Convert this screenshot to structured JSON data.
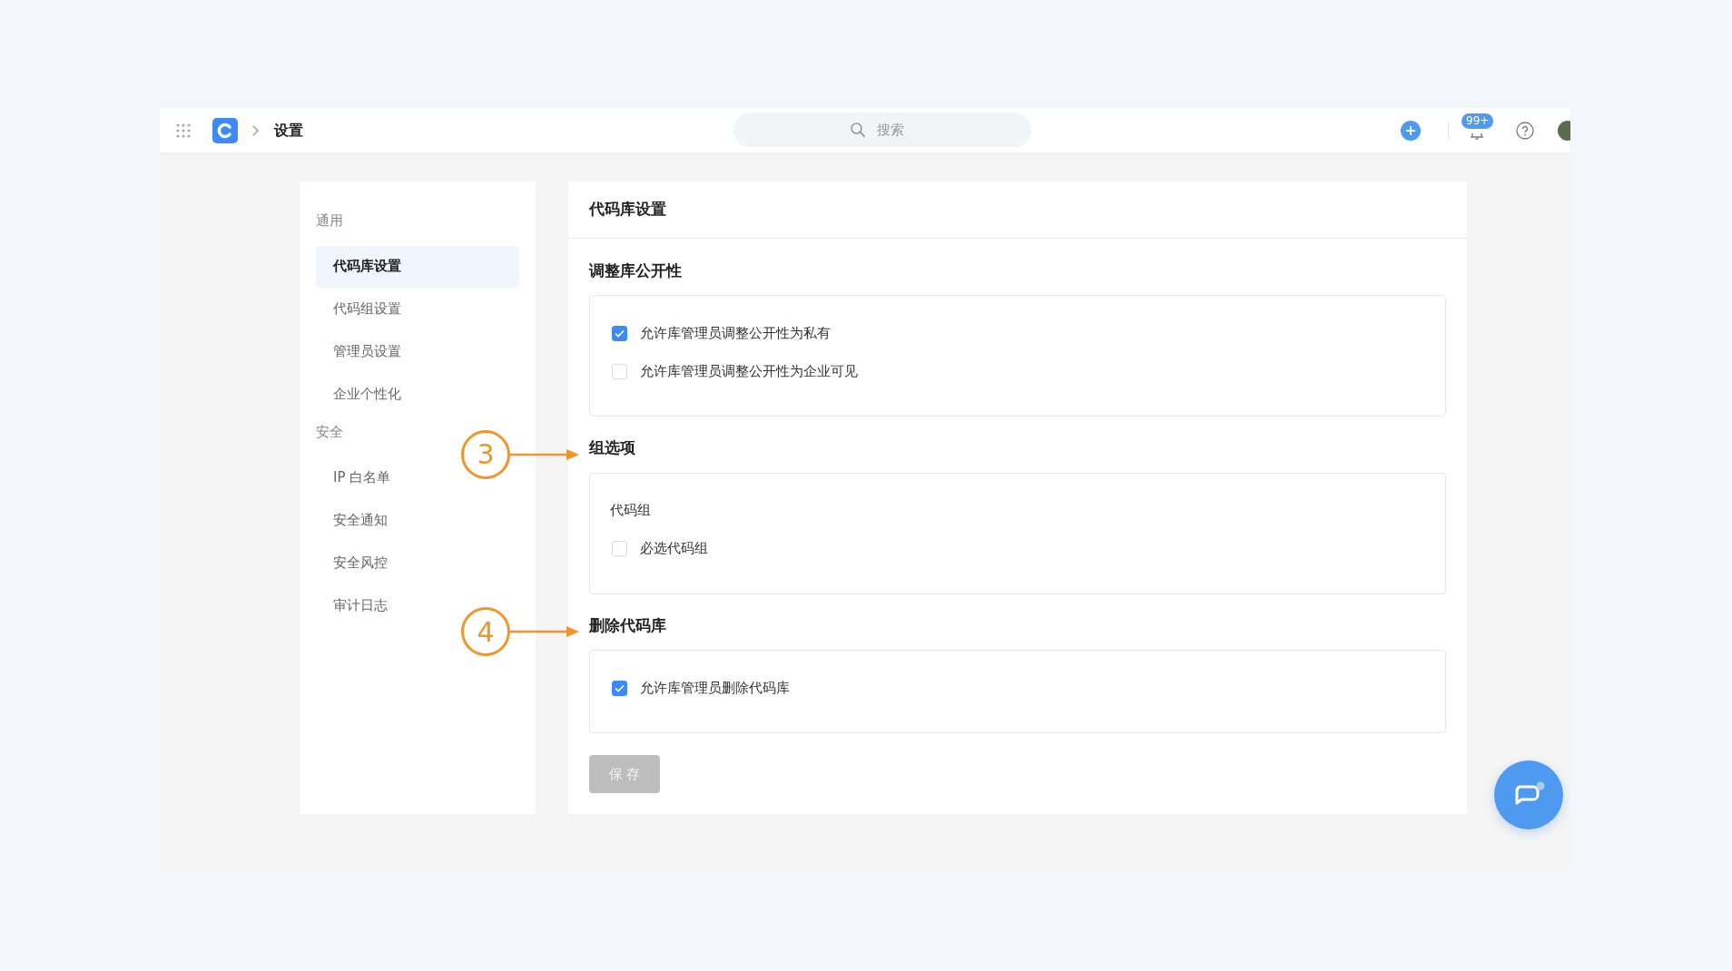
{
  "header": {
    "breadcrumb": "设置",
    "search": {
      "placeholder": "搜索"
    },
    "notification_badge": "99+"
  },
  "sidebar": {
    "groups": [
      {
        "title": "通用",
        "items": [
          {
            "label": "代码库设置",
            "selected": true
          },
          {
            "label": "代码组设置",
            "selected": false
          },
          {
            "label": "管理员设置",
            "selected": false
          },
          {
            "label": "企业个性化",
            "selected": false
          }
        ]
      },
      {
        "title": "安全",
        "items": [
          {
            "label": "IP 白名单",
            "selected": false
          },
          {
            "label": "安全通知",
            "selected": false
          },
          {
            "label": "安全风控",
            "selected": false
          },
          {
            "label": "审计日志",
            "selected": false
          }
        ]
      }
    ]
  },
  "panel": {
    "title": "代码库设置",
    "sections": [
      {
        "title": "调整库公开性",
        "items": [
          {
            "kind": "checkbox",
            "label": "允许库管理员调整公开性为私有",
            "checked": true
          },
          {
            "kind": "checkbox",
            "label": "允许库管理员调整公开性为企业可见",
            "checked": false
          }
        ]
      },
      {
        "title": "组选项",
        "callout": "3",
        "items": [
          {
            "kind": "heading",
            "label": "代码组"
          },
          {
            "kind": "checkbox",
            "label": "必选代码组",
            "checked": false
          }
        ]
      },
      {
        "title": "删除代码库",
        "callout": "4",
        "items": [
          {
            "kind": "checkbox",
            "label": "允许库管理员删除代码库",
            "checked": true
          }
        ]
      }
    ],
    "save_button": {
      "label": "保 存",
      "disabled": true
    }
  }
}
